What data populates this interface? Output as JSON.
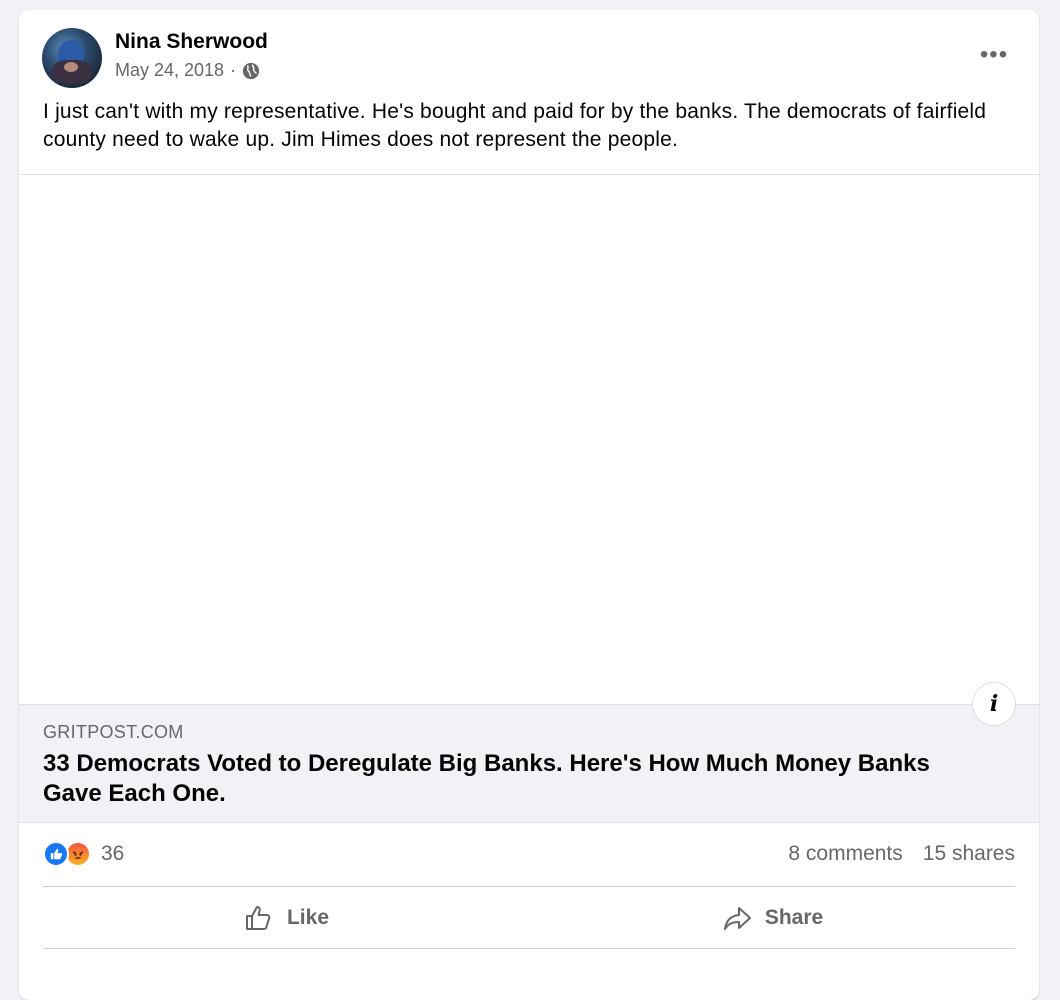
{
  "post": {
    "author": "Nina Sherwood",
    "date": "May 24, 2018",
    "separator": "·",
    "privacy_icon": "globe-icon",
    "more_icon": "more-options-icon",
    "more_label": "•••",
    "text": "I just can't with my representative.  He's bought and paid for by the banks. The democrats of fairfield county need to wake up. Jim Himes does not represent the people."
  },
  "link_preview": {
    "domain": "GRITPOST.COM",
    "headline": "33 Democrats Voted to Deregulate Big Banks. Here's How Much Money Banks Gave Each One.",
    "info_label": "i"
  },
  "stats": {
    "reaction_icons": [
      "like-reaction-icon",
      "angry-reaction-icon"
    ],
    "reaction_count": "36",
    "comments": "8 comments",
    "shares": "15 shares"
  },
  "actions": {
    "like_label": "Like",
    "share_label": "Share"
  },
  "colors": {
    "background": "#f0f2f5",
    "card": "#ffffff",
    "like_blue": "#1877f2",
    "secondary_text": "#65676b"
  }
}
